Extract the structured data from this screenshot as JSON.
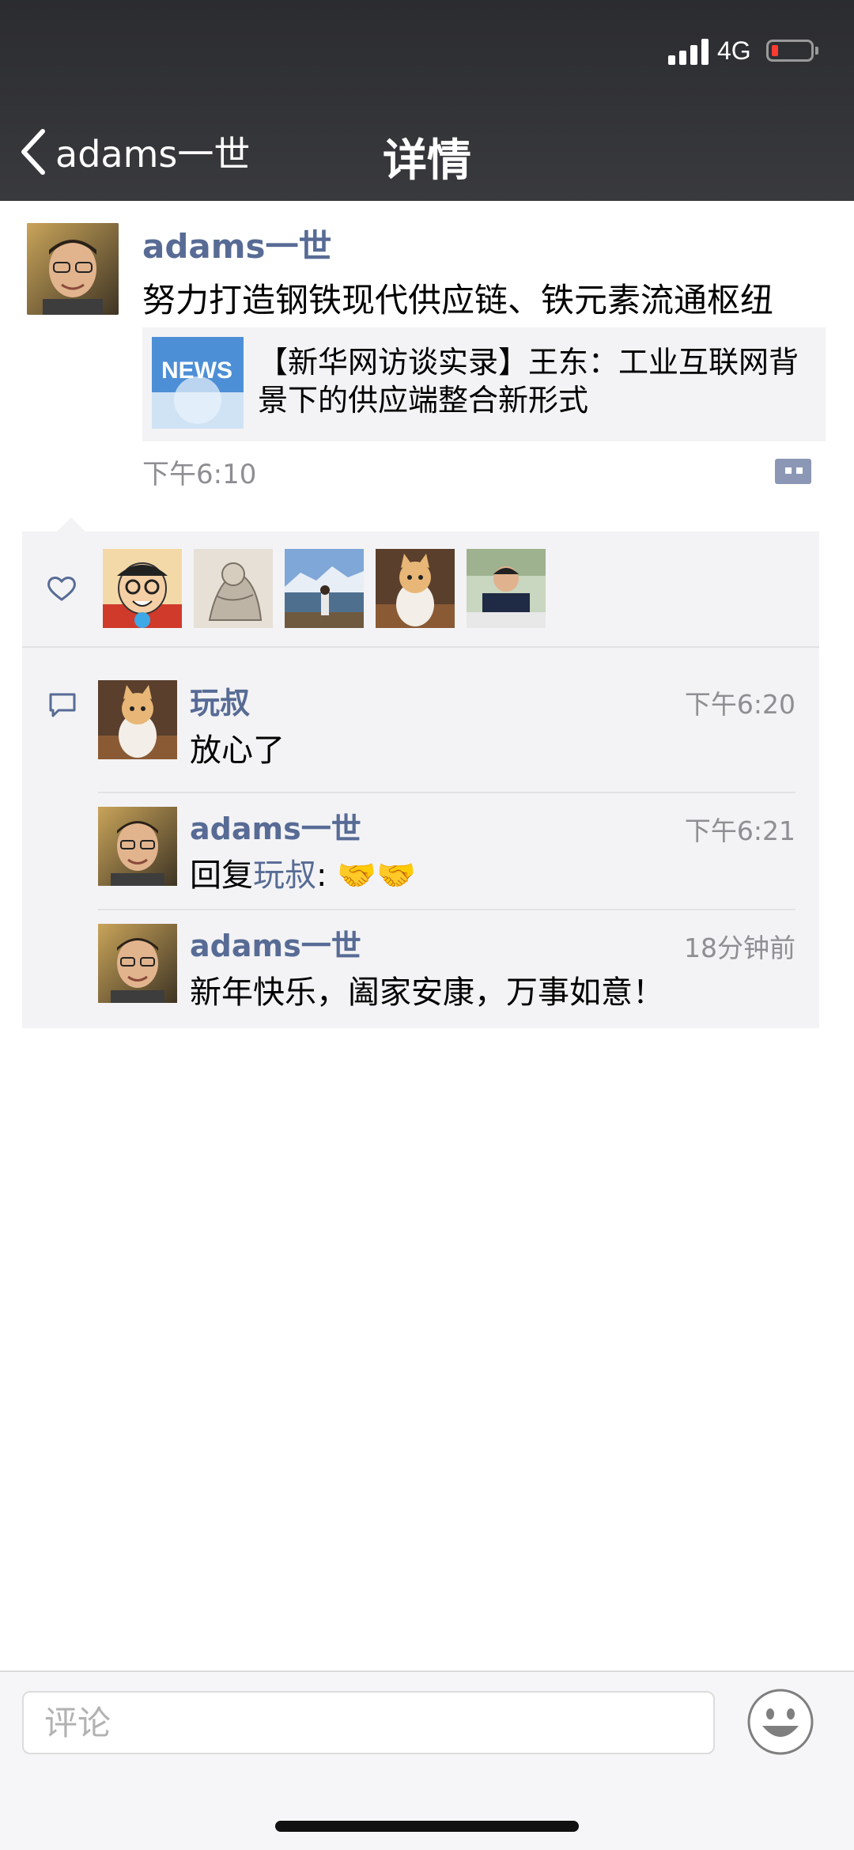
{
  "status_bar": {
    "network": "4G",
    "signal_bars": 4,
    "battery_level": 0.08,
    "battery_color": "#ff3b30"
  },
  "nav": {
    "back_label": "adams一世",
    "title": "详情"
  },
  "post": {
    "author": "adams一世",
    "text": "努力打造钢铁现代供应链、铁元素流通枢纽",
    "link": {
      "title": "【新华网访谈实录】王东：工业互联网背景下的供应端整合新形式",
      "thumb_label": "NEWS"
    },
    "time": "下午6:10"
  },
  "likes": {
    "icon": "heart-icon",
    "count": 5
  },
  "comments": [
    {
      "author": "玩叔",
      "time": "下午6:20",
      "text": "放心了"
    },
    {
      "author": "adams一世",
      "time": "下午6:21",
      "reply_prefix": "回复",
      "reply_to": "玩叔",
      "reply_sep": ": ",
      "text": "🤝🤝"
    },
    {
      "author": "adams一世",
      "time": "18分钟前",
      "text": "新年快乐，阖家安康，万事如意！"
    }
  ],
  "comment_input": {
    "placeholder": "评论"
  },
  "colors": {
    "link_blue": "#576b95",
    "header_bg": "#2e2f33",
    "panel_bg": "#f3f3f5"
  }
}
